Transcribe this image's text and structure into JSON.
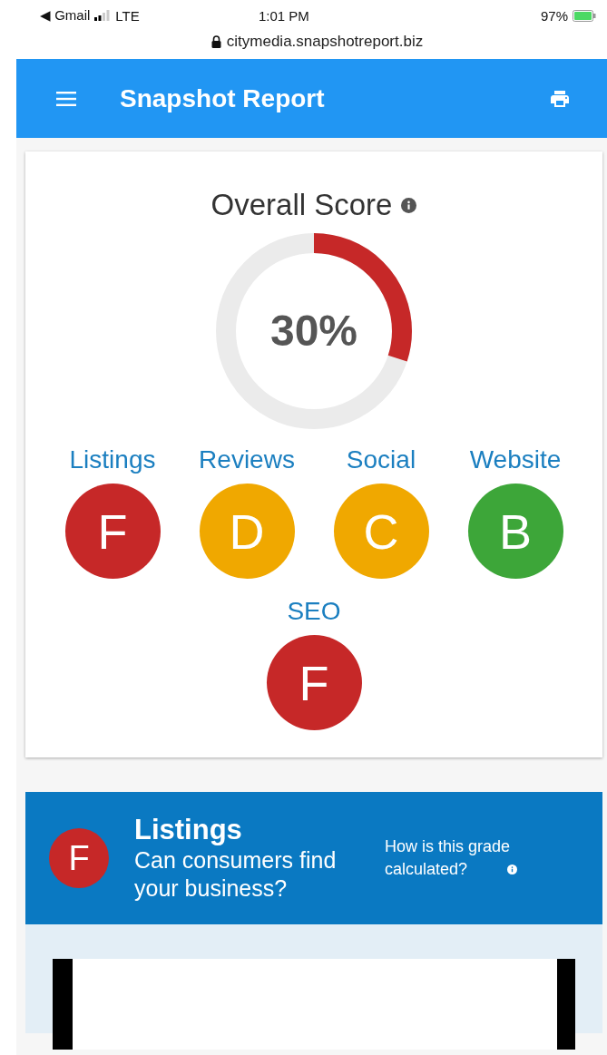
{
  "status_bar": {
    "back_app": "◀ Gmail",
    "network": "LTE",
    "time": "1:01 PM",
    "battery": "97%"
  },
  "address_bar": {
    "url": "citymedia.snapshotreport.biz"
  },
  "app_bar": {
    "title": "Snapshot Report"
  },
  "overall": {
    "title": "Overall Score",
    "level": 0.3,
    "reading": "30%"
  },
  "grades": [
    {
      "label": "Listings",
      "grade": "F",
      "color": "#c62828"
    },
    {
      "label": "Reviews",
      "grade": "D",
      "color": "#f0a800"
    },
    {
      "label": "Social",
      "grade": "C",
      "color": "#f0a800"
    },
    {
      "label": "Website",
      "grade": "B",
      "color": "#3da639"
    },
    {
      "label": "SEO",
      "grade": "F",
      "color": "#c62828"
    }
  ],
  "section": {
    "grade": "F",
    "color": "#c62828",
    "title": "Listings",
    "subtitle": "Can consumers find your business?",
    "help_link": "How is this grade calculated?"
  }
}
